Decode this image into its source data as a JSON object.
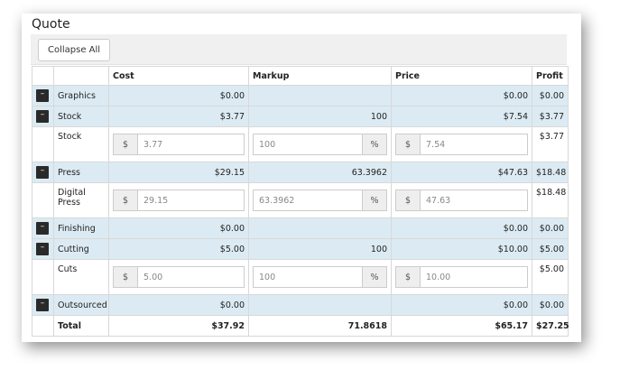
{
  "title": "Quote",
  "collapse_all_label": "Collapse All",
  "columns": {
    "cost": "Cost",
    "markup": "Markup",
    "price": "Price",
    "profit": "Profit"
  },
  "toggle_glyph": "–",
  "addons": {
    "currency": "$",
    "percent": "%"
  },
  "rows": {
    "graphics": {
      "label": "Graphics",
      "cost": "$0.00",
      "markup": "",
      "price": "$0.00",
      "profit": "$0.00"
    },
    "stock": {
      "label": "Stock",
      "cost": "$3.77",
      "markup": "100",
      "price": "$7.54",
      "profit": "$3.77"
    },
    "stock_detail": {
      "label": "Stock",
      "cost": "3.77",
      "markup": "100",
      "price": "7.54",
      "profit": "$3.77"
    },
    "press": {
      "label": "Press",
      "cost": "$29.15",
      "markup": "63.3962",
      "price": "$47.63",
      "profit": "$18.48"
    },
    "digital_press": {
      "label": "Digital Press",
      "cost": "29.15",
      "markup": "63.3962",
      "price": "47.63",
      "profit": "$18.48"
    },
    "finishing": {
      "label": "Finishing",
      "cost": "$0.00",
      "markup": "",
      "price": "$0.00",
      "profit": "$0.00"
    },
    "cutting": {
      "label": "Cutting",
      "cost": "$5.00",
      "markup": "100",
      "price": "$10.00",
      "profit": "$5.00"
    },
    "cuts": {
      "label": "Cuts",
      "cost": "5.00",
      "markup": "100",
      "price": "10.00",
      "profit": "$5.00"
    },
    "outsourced": {
      "label": "Outsourced",
      "cost": "$0.00",
      "markup": "",
      "price": "$0.00",
      "profit": "$0.00"
    }
  },
  "total": {
    "label": "Total",
    "cost": "$37.92",
    "markup": "71.8618",
    "price": "$65.17",
    "profit": "$27.25"
  }
}
